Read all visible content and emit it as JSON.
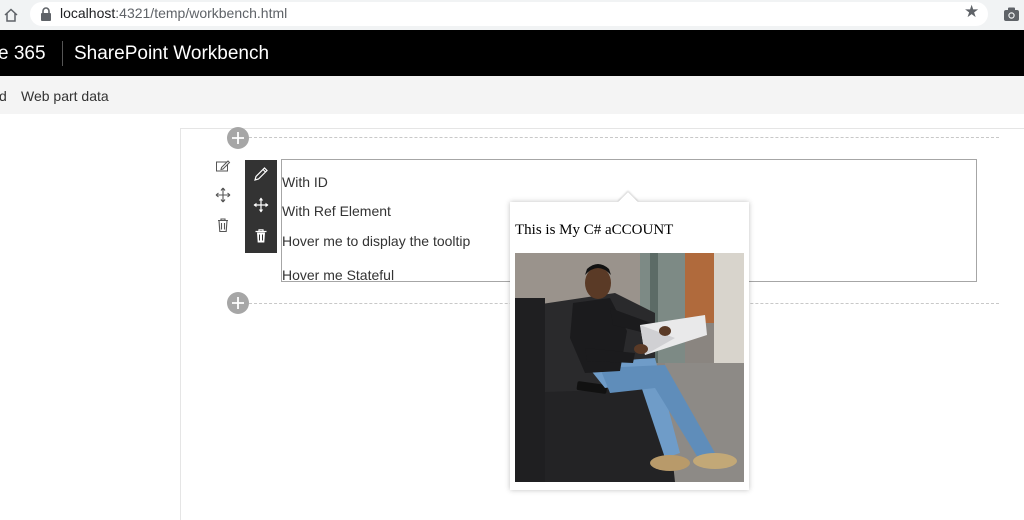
{
  "browser": {
    "url_host": "localhost",
    "url_path": ":4321/temp/workbench.html",
    "star_icon": "★"
  },
  "suite": {
    "brand": "e 365",
    "title": "SharePoint Workbench"
  },
  "command_bar": {
    "partial_item": "d",
    "web_part_data": "Web part data"
  },
  "webpart": {
    "items": [
      "With ID",
      "With Ref Element",
      "Hover me to display the tooltip",
      "Hover me Stateful"
    ]
  },
  "tooltip": {
    "text": "This is My C# aCCOUNT",
    "image": "person-photo"
  },
  "icons": {
    "home": "home-icon",
    "lock": "lock-icon",
    "star": "star-icon",
    "camera": "camera-icon",
    "edit": "edit-icon",
    "move": "move-icon",
    "delete": "delete-icon",
    "add": "add-icon"
  },
  "colors": {
    "suite_bar": "#000000",
    "command_bar": "#f4f4f4",
    "toolbar": "#333333"
  }
}
